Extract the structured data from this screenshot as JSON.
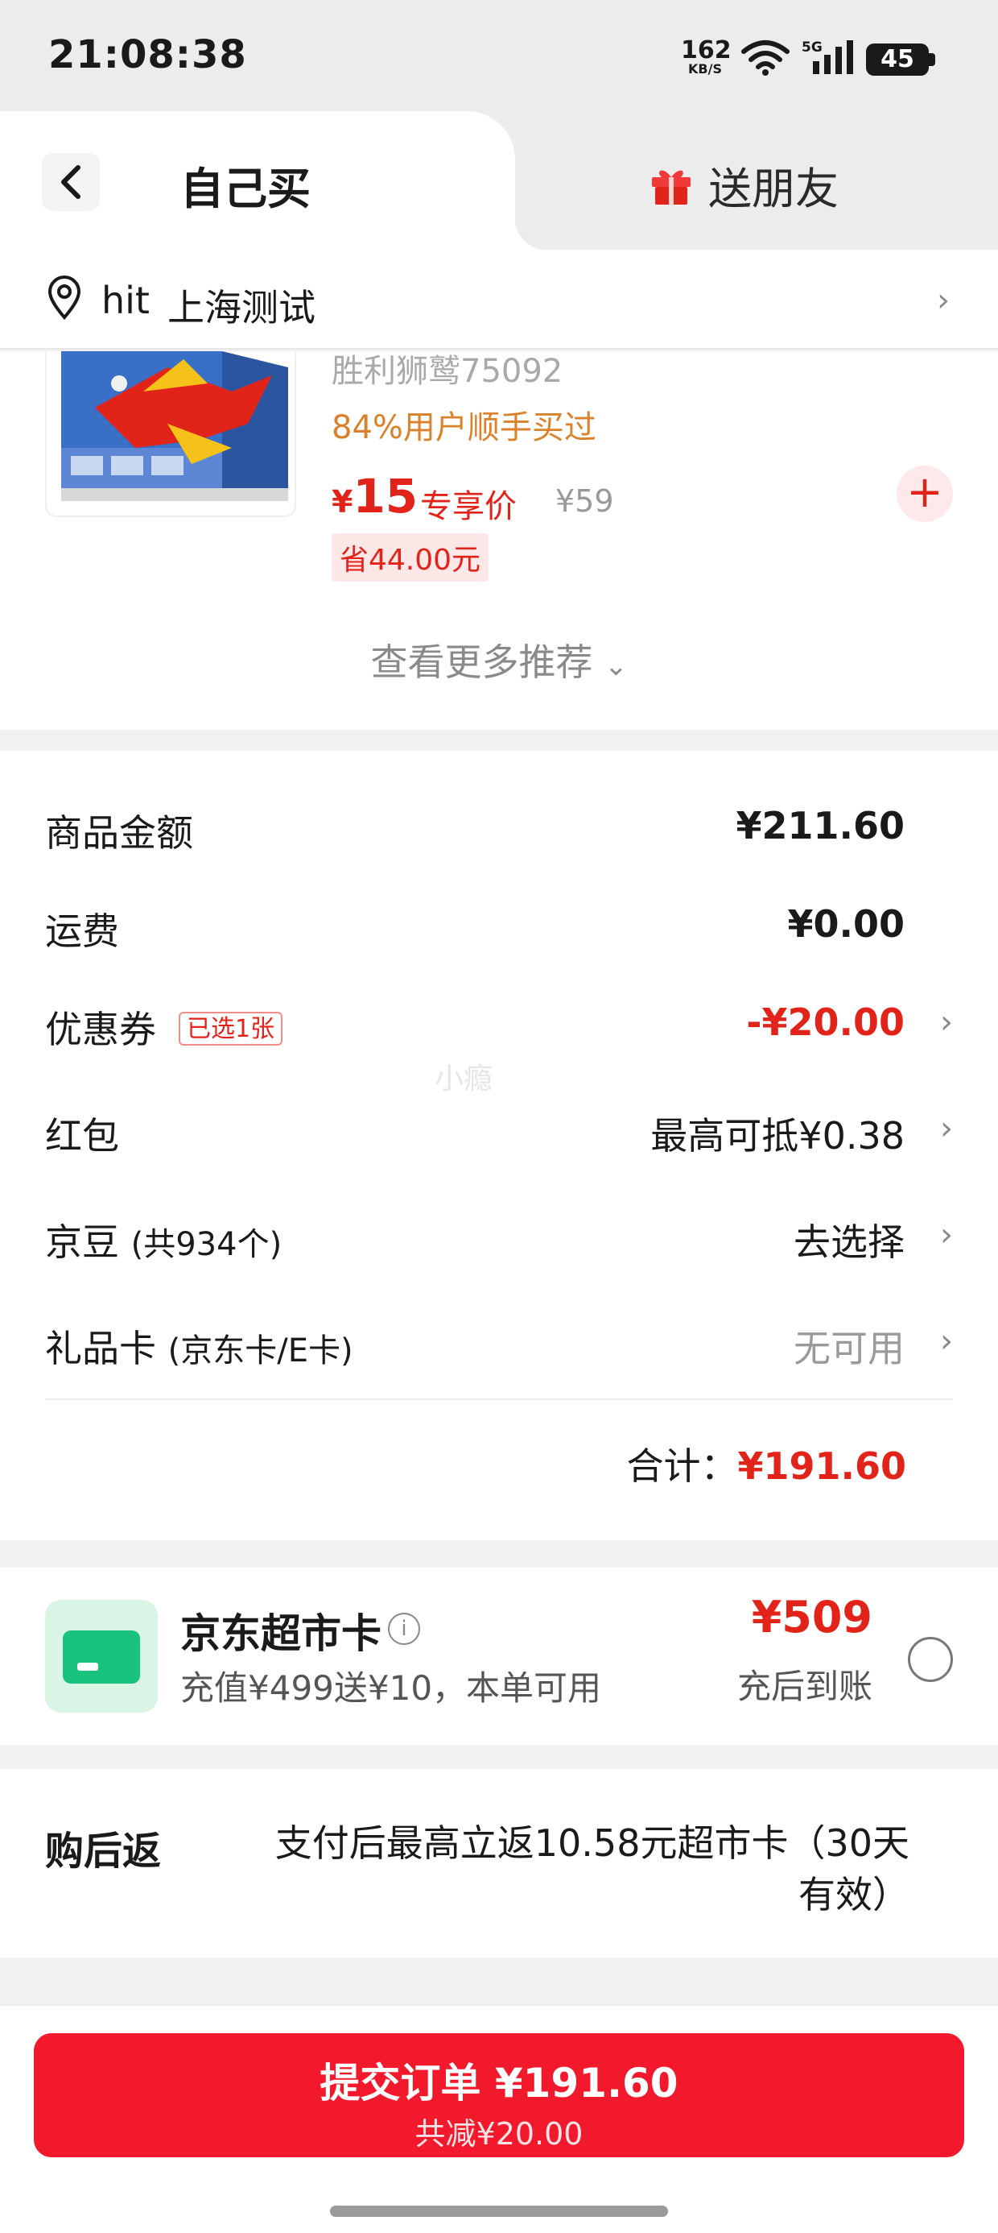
{
  "status_bar": {
    "time": "21:08:38",
    "net_speed": "162",
    "net_unit": "KB/S",
    "network": "5G",
    "battery": "45"
  },
  "header": {
    "tab_self": "自己买",
    "tab_gift": "送朋友"
  },
  "address": {
    "name": "hit",
    "location": "上海测试"
  },
  "recommend": {
    "product_name": "胜利狮鹫75092",
    "bought_rate": "84%用户顺手买过",
    "currency": "¥",
    "price": "15",
    "price_label": "专享价",
    "original_price": "¥59",
    "saving": "省44.00元",
    "more": "查看更多推荐"
  },
  "summary": {
    "goods_label": "商品金额",
    "goods_value": "¥211.60",
    "shipping_label": "运费",
    "shipping_value": "¥0.00",
    "coupon_label": "优惠券",
    "coupon_tag": "已选1张",
    "coupon_value": "-¥20.00",
    "redpacket_label": "红包",
    "redpacket_value": "最高可抵¥0.38",
    "beans_label": "京豆",
    "beans_sub": "(共934个)",
    "beans_value": "去选择",
    "giftcard_label": "礼品卡",
    "giftcard_sub": "(京东卡/E卡)",
    "giftcard_value": "无可用",
    "total_label": "合计：",
    "total_value": "¥191.60",
    "watermark": "小瘾"
  },
  "supermarket_card": {
    "title": "京东超市卡",
    "desc": "充值¥499送¥10，本单可用",
    "price": "¥509",
    "sub": "充后到账"
  },
  "rebate": {
    "label": "购后返",
    "text": "支付后最高立返10.58元超市卡（30天有效）"
  },
  "submit": {
    "label": "提交订单 ¥191.60",
    "reduction": "共减¥20.00"
  },
  "colors": {
    "accent_red": "#e2231a",
    "button_red": "#f2192c",
    "card_green": "#19c37d"
  }
}
